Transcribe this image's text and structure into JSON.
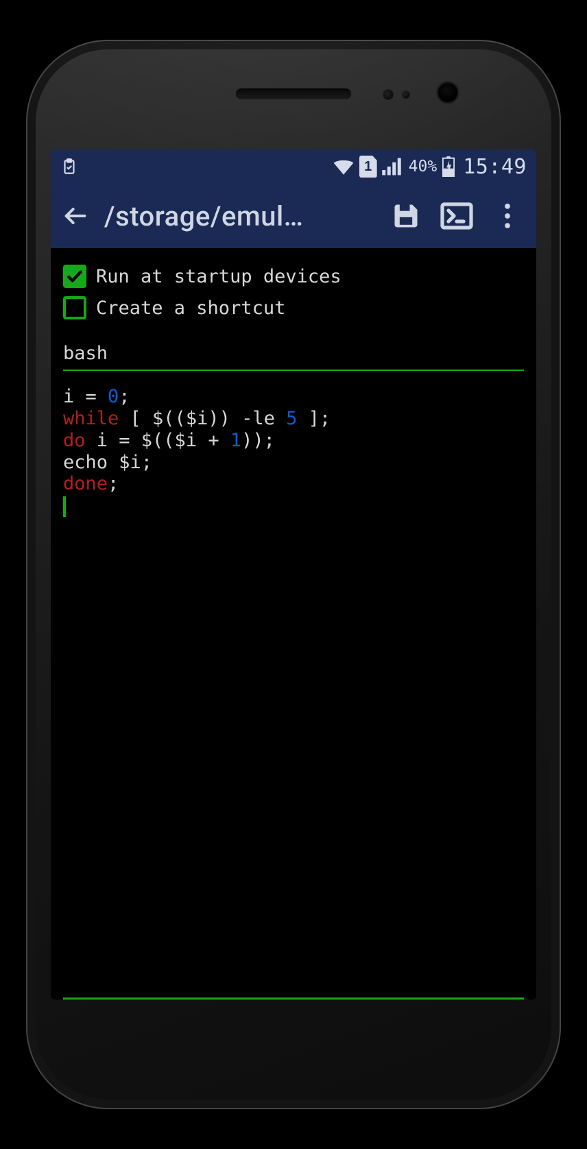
{
  "statusbar": {
    "battery_pct": "40%",
    "time": "15:49"
  },
  "appbar": {
    "title": "/storage/emul…"
  },
  "options": {
    "run_at_startup": {
      "label": "Run at startup devices",
      "checked": true
    },
    "create_shortcut": {
      "label": "Create a shortcut",
      "checked": false
    }
  },
  "shell_field": {
    "value": "bash"
  },
  "code": {
    "l1_a": "i = ",
    "l1_num": "0",
    "l1_b": ";",
    "l2_kw": "while",
    "l2_a": " [ $(($i)) -le ",
    "l2_num": "5",
    "l2_b": " ];",
    "l3_kw": "do",
    "l3_a": " i = $(($i + ",
    "l3_num": "1",
    "l3_b": "));",
    "l4": "echo $i;",
    "l5_kw": "done",
    "l5_a": ";"
  }
}
